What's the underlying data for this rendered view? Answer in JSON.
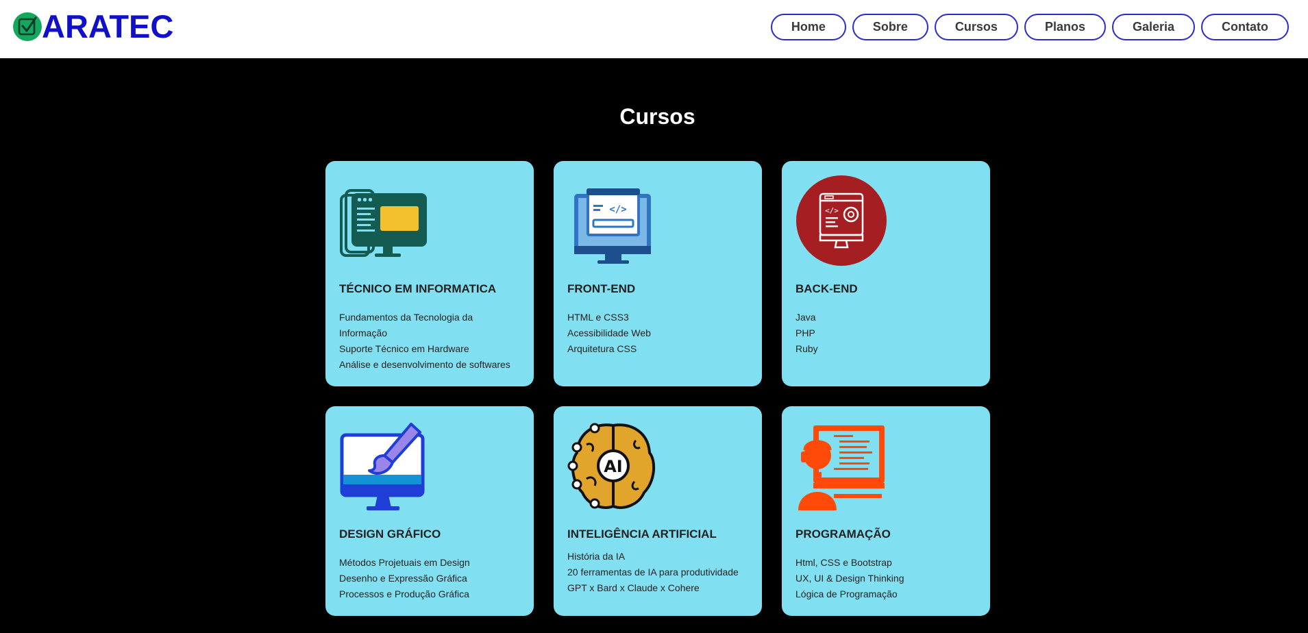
{
  "brand": {
    "name": "ARATEC",
    "icon": "checkbox-logo-icon"
  },
  "nav": {
    "items": [
      "Home",
      "Sobre",
      "Cursos",
      "Planos",
      "Galeria",
      "Contato"
    ]
  },
  "section": {
    "title": "Cursos"
  },
  "courses": [
    {
      "title": "TÉCNICO EM INFORMATICA",
      "icon": "computer-screens-icon",
      "items": [
        "Fundamentos da Tecnologia da",
        "Informação",
        "Suporte Técnico em Hardware",
        "Análise e desenvolvimento de softwares"
      ]
    },
    {
      "title": "FRONT-END",
      "icon": "code-monitor-icon",
      "items": [
        "HTML e CSS3",
        "Acessibilidade Web",
        "Arquitetura CSS"
      ]
    },
    {
      "title": "BACK-END",
      "icon": "code-gear-monitor-icon",
      "items": [
        "Java",
        "PHP",
        "Ruby"
      ]
    },
    {
      "title": "DESIGN GRÁFICO",
      "icon": "paintbrush-monitor-icon",
      "items": [
        "Métodos Projetuais em Design",
        "Desenho e Expressão Gráfica",
        "Processos e Produção Gráfica"
      ]
    },
    {
      "title": "INTELIGÊNCIA ARTIFICIAL",
      "icon": "ai-brain-icon",
      "icon_label": "AI",
      "items": [
        "História da IA",
        "20 ferramentas de IA para produtividade",
        "GPT x Bard x Claude x Cohere"
      ]
    },
    {
      "title": "PROGRAMAÇÃO",
      "icon": "programmer-monitor-icon",
      "items": [
        "Html, CSS e Bootstrap",
        "UX, UI & Design Thinking",
        "Lógica de Programação"
      ]
    }
  ],
  "colors": {
    "brand": "#1010c8",
    "card": "#80dff0",
    "background": "#000000",
    "nav_border": "#2a2ad0"
  }
}
